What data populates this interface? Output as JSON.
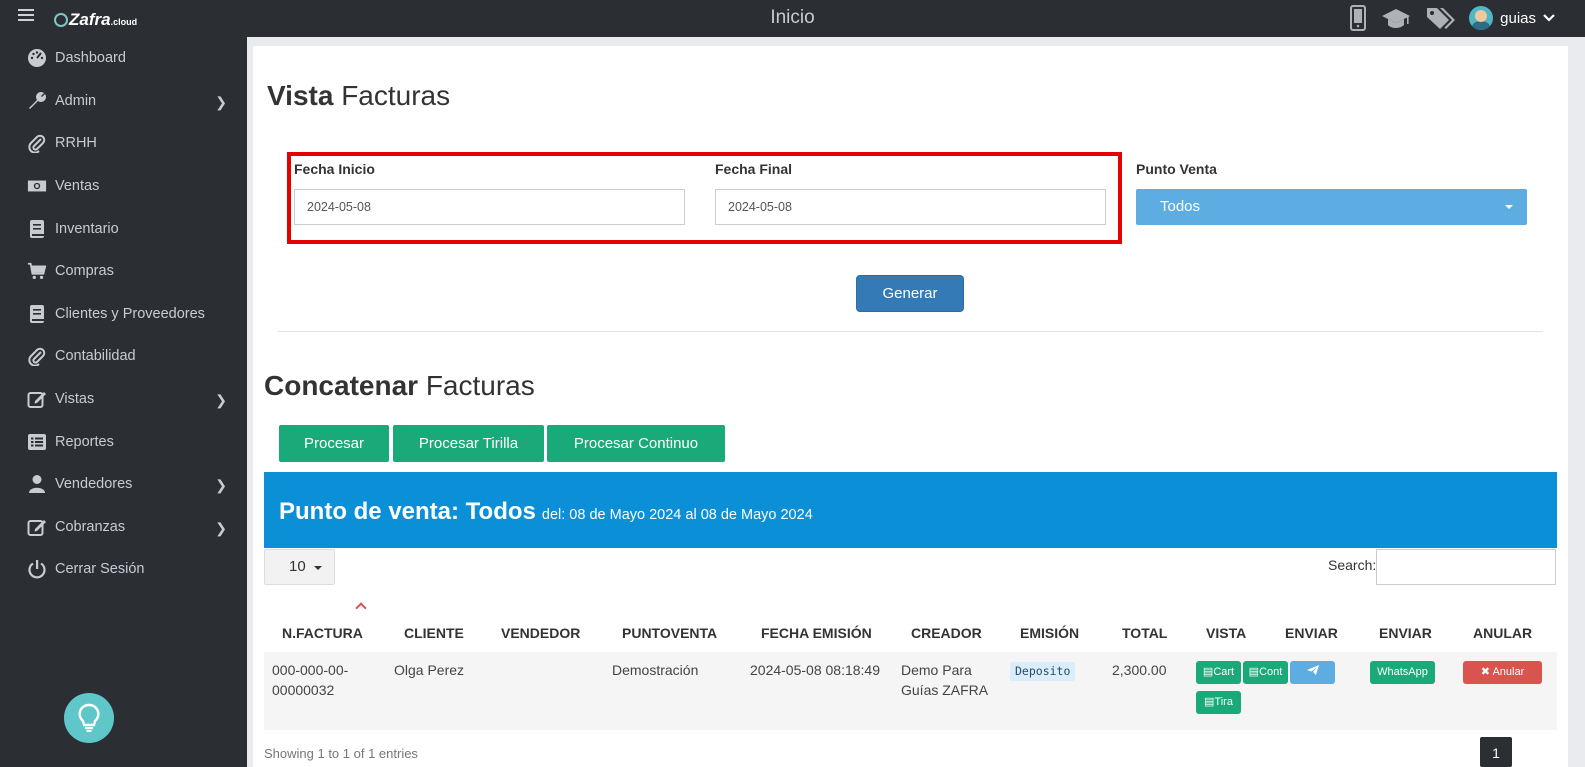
{
  "topbar": {
    "title": "Inicio",
    "logo_text": "Zafra",
    "logo_suffix": ".cloud",
    "username": "guias",
    "icons": [
      "menu-icon",
      "mobile-icon",
      "graduation-cap-icon",
      "tags-icon",
      "chevron-down-icon"
    ]
  },
  "sidebar": {
    "items": [
      {
        "label": "Dashboard",
        "icon": "dashboard-icon",
        "has_submenu": false
      },
      {
        "label": "Admin",
        "icon": "wrench-icon",
        "has_submenu": true
      },
      {
        "label": "RRHH",
        "icon": "paperclip-icon",
        "has_submenu": false
      },
      {
        "label": "Ventas",
        "icon": "money-icon",
        "has_submenu": false
      },
      {
        "label": "Inventario",
        "icon": "book-icon",
        "has_submenu": false
      },
      {
        "label": "Compras",
        "icon": "cart-icon",
        "has_submenu": false
      },
      {
        "label": "Clientes y Proveedores",
        "icon": "book-icon",
        "has_submenu": false
      },
      {
        "label": "Contabilidad",
        "icon": "paperclip-icon",
        "has_submenu": false
      },
      {
        "label": "Vistas",
        "icon": "edit-icon",
        "has_submenu": true
      },
      {
        "label": "Reportes",
        "icon": "list-icon",
        "has_submenu": false
      },
      {
        "label": "Vendedores",
        "icon": "user-icon",
        "has_submenu": true
      },
      {
        "label": "Cobranzas",
        "icon": "edit-icon",
        "has_submenu": true
      },
      {
        "label": "Cerrar Sesión",
        "icon": "power-icon",
        "has_submenu": false
      }
    ]
  },
  "vista": {
    "title_bold": "Vista",
    "title_rest": "Facturas",
    "fecha_inicio_label": "Fecha Inicio",
    "fecha_inicio_value": "2024-05-08",
    "fecha_final_label": "Fecha Final",
    "fecha_final_value": "2024-05-08",
    "punto_venta_label": "Punto Venta",
    "punto_venta_value": "Todos",
    "generar_label": "Generar"
  },
  "concatenar": {
    "title_bold": "Concatenar",
    "title_rest": "Facturas",
    "buttons": [
      "Procesar",
      "Procesar Tirilla",
      "Procesar Continuo"
    ]
  },
  "report": {
    "banner_title": "Punto de venta: Todos",
    "banner_subtitle": "del: 08 de Mayo 2024 al 08 de Mayo 2024",
    "page_length": "10",
    "search_label": "Search:",
    "columns": [
      "N.FACTURA",
      "CLIENTE",
      "VENDEDOR",
      "PUNTOVENTA",
      "FECHA EMISIÓN",
      "CREADOR",
      "EMISIÓN",
      "TOTAL",
      "VISTA",
      "ENVIAR",
      "ENVIAR",
      "ANULAR"
    ],
    "rows": [
      {
        "factura_line1": "000-000-00-",
        "factura_line2": "00000032",
        "cliente": "Olga Perez",
        "vendedor": "",
        "puntoventa": "Demostración",
        "fecha_emision": "2024-05-08 08:18:49",
        "creador_line1": "Demo Para",
        "creador_line2": "Guías ZAFRA",
        "emision": "Deposito",
        "total": "2,300.00",
        "vista_buttons": [
          "Cart",
          "Cont",
          "Tira"
        ],
        "whatsapp_label": "WhatsApp",
        "anular_label": "Anular"
      }
    ],
    "showing_text": "Showing 1 to 1 of 1 entries",
    "current_page": "1"
  },
  "colors": {
    "sidebar_bg": "#2b2e33",
    "banner": "#0b90d8",
    "green_button": "#1aaa7a",
    "primary_button": "#337ab7",
    "select_blue": "#5dade2",
    "danger": "#d9534f",
    "highlight_frame": "#e60000"
  }
}
